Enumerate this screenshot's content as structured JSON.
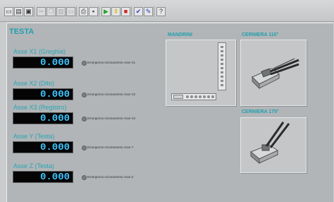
{
  "toolbar": {
    "buttons": [
      {
        "icon": "new-file-icon",
        "glyph": "▭",
        "enabled": true
      },
      {
        "icon": "open-folder-icon",
        "glyph": "▤",
        "enabled": true
      },
      {
        "icon": "save-icon",
        "glyph": "▣",
        "enabled": true
      },
      {
        "icon": "cut-icon",
        "glyph": "✂",
        "enabled": false
      },
      {
        "icon": "copy-icon",
        "glyph": "❐",
        "enabled": false
      },
      {
        "icon": "paste-icon",
        "glyph": "▥",
        "enabled": false
      },
      {
        "icon": "delete-icon",
        "glyph": "▭",
        "enabled": false
      },
      {
        "icon": "print-icon",
        "glyph": "⎙",
        "enabled": true
      },
      {
        "icon": "monitor-icon",
        "glyph": "▪",
        "enabled": true
      },
      {
        "icon": "play-icon",
        "glyph": "▶",
        "enabled": true,
        "color": "#2aa52a"
      },
      {
        "icon": "pause-icon",
        "glyph": "Ⅱ",
        "enabled": true,
        "color": "#d8b000"
      },
      {
        "icon": "stop-icon",
        "glyph": "■",
        "enabled": true,
        "color": "#d02020"
      },
      {
        "icon": "check-icon",
        "glyph": "✔",
        "enabled": true,
        "color": "#2040c0"
      },
      {
        "icon": "brush-icon",
        "glyph": "✎",
        "enabled": true,
        "color": "#2040c0"
      },
      {
        "icon": "help-icon",
        "glyph": "?",
        "enabled": true
      }
    ]
  },
  "page_title": "TESTA",
  "axes": [
    {
      "label": "Asse X1 (Greghia)",
      "value": "0.000",
      "emergency": "Emergenza Azionamento Asse X1"
    },
    {
      "label": "Asse X2 (Dito)",
      "value": "0.000",
      "emergency": "Emergenza Azionamento Asse X2"
    },
    {
      "label": "Asse X3 (Registro)",
      "value": "0.000",
      "emergency": "Emergenza Azionamento Asse X3"
    },
    {
      "label": "Asse Y (Testa)",
      "value": "0.000",
      "emergency": "Emergenza Azionamento Asse Y"
    },
    {
      "label": "Asse Z (Testa)",
      "value": "0.000",
      "emergency": "Emergenza Azionamento Asse Z"
    }
  ],
  "sections": {
    "mandrini": "MANDRINI",
    "cerniera_110": "CERNIERA 110°",
    "cerniera_175": "CERNIERA 175°"
  },
  "colors": {
    "accent": "#20a0b0",
    "display_text": "#3fc4ff",
    "display_bg": "#050505"
  }
}
